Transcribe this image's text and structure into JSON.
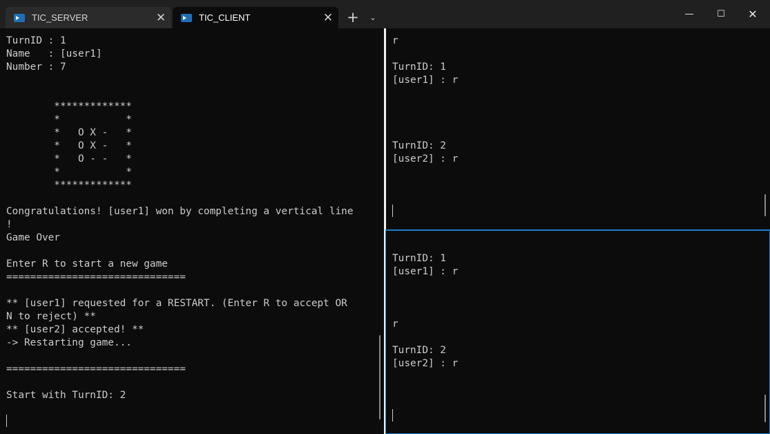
{
  "tabs": [
    {
      "label": "TIC_SERVER",
      "active": false
    },
    {
      "label": "TIC_CLIENT",
      "active": true
    }
  ],
  "titlebar": {
    "new_tab_glyph": "+",
    "dropdown_glyph": "⌄",
    "minimize_glyph": "—",
    "maximize_glyph": "☐",
    "close_glyph": "✕",
    "tab_close_glyph": "✕"
  },
  "panes": {
    "left": {
      "lines": [
        "TurnID : 1",
        "Name   : [user1]",
        "Number : 7",
        "",
        "",
        "        *************",
        "        *           *",
        "        *   O X -   *",
        "        *   O X -   *",
        "        *   O - -   *",
        "        *           *",
        "        *************",
        "",
        "Congratulations! [user1] won by completing a vertical line",
        "!",
        "Game Over",
        "",
        "Enter R to start a new game",
        "==============================",
        "",
        "** [user1] requested for a RESTART. (Enter R to accept OR",
        "N to reject) **",
        "** [user2] accepted! **",
        "-> Restarting game...",
        "",
        "==============================",
        "",
        "Start with TurnID: 2"
      ]
    },
    "top_right": {
      "lines": [
        "r",
        "",
        "TurnID: 1",
        "[user1] : r",
        "",
        "",
        "",
        "",
        "TurnID: 2",
        "[user2] : r"
      ]
    },
    "bottom_right": {
      "lines": [
        "",
        "TurnID: 1",
        "[user1] : r",
        "",
        "",
        "",
        "r",
        "",
        "TurnID: 2",
        "[user2] : r"
      ]
    }
  },
  "colors": {
    "background": "#0c0c0c",
    "titlebar": "#202020",
    "text": "#cccccc",
    "focus_border": "#1e7fd0"
  }
}
